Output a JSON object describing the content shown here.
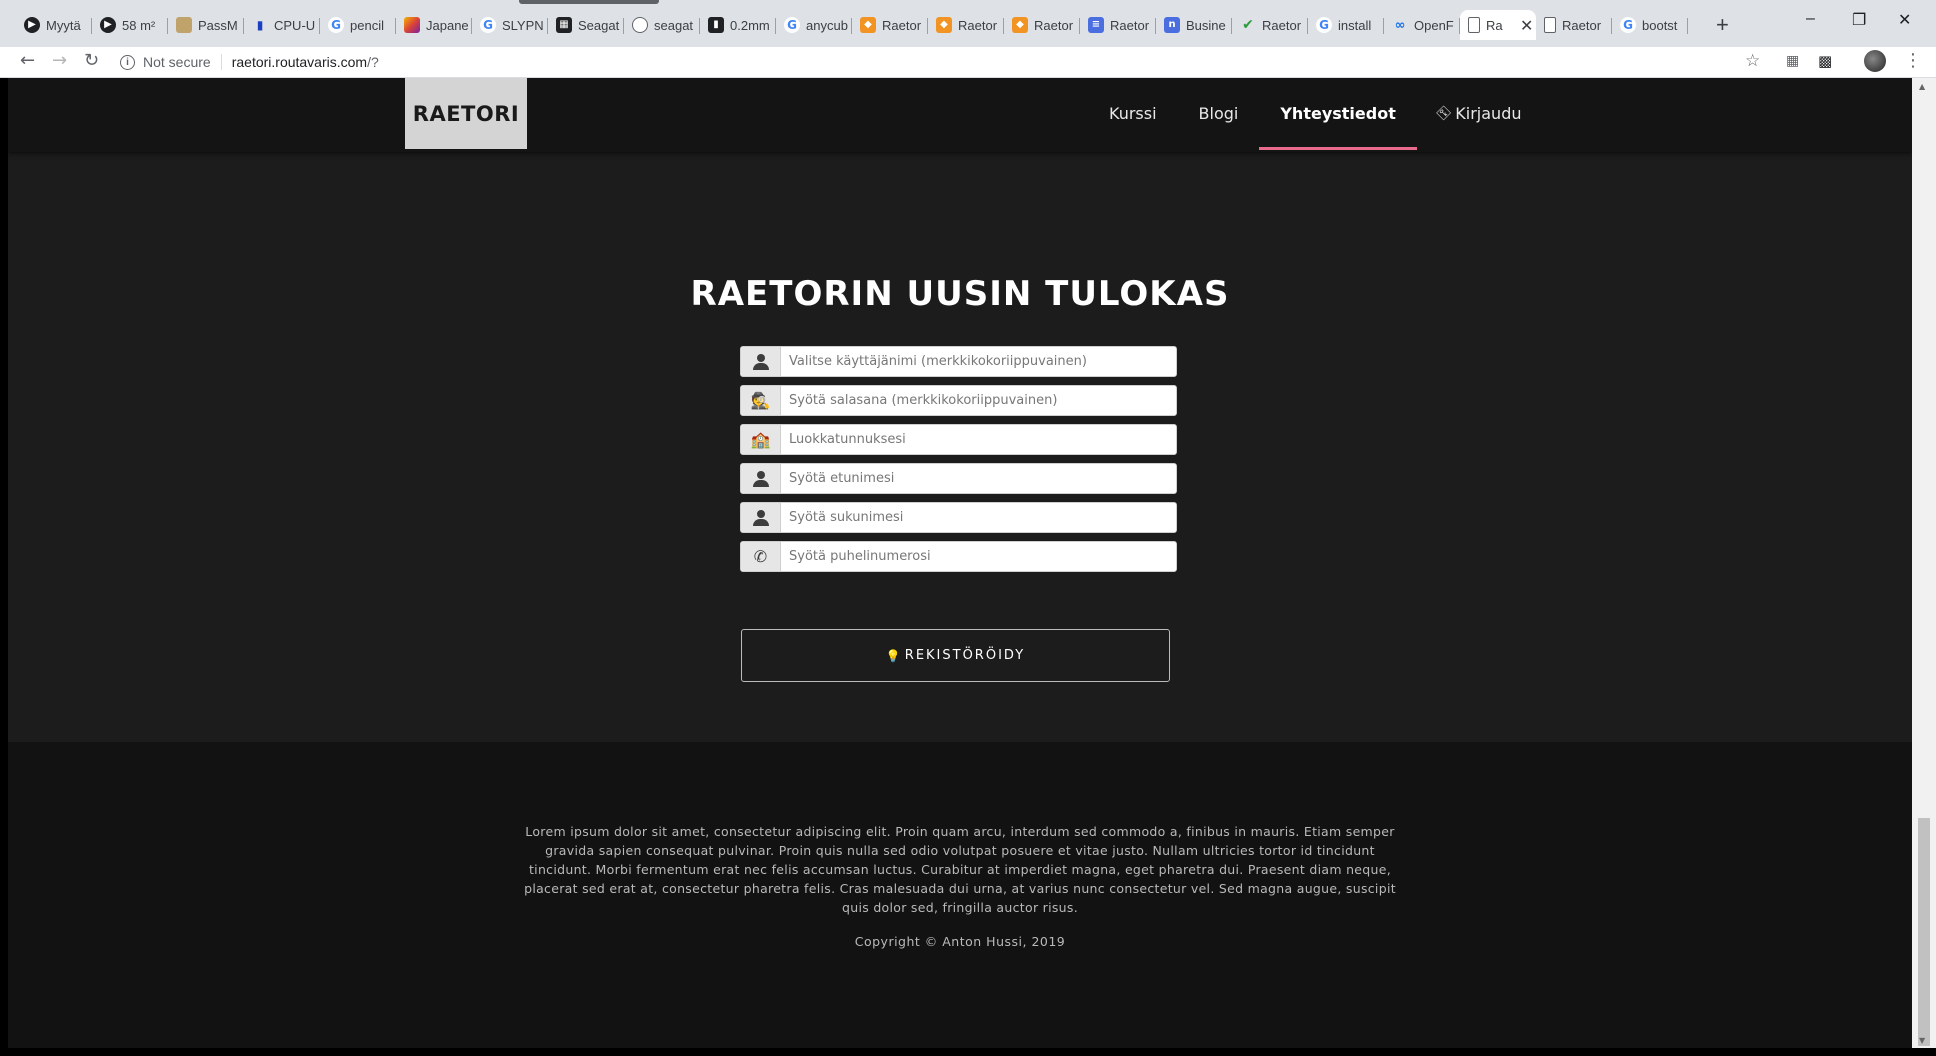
{
  "browser": {
    "tabs": [
      {
        "label": "Myytä",
        "icon": "circle-play-icon"
      },
      {
        "label": "58 m²",
        "icon": "circle-play-icon"
      },
      {
        "label": "PassM",
        "icon": "book-icon"
      },
      {
        "label": "CPU-U",
        "icon": "bar-chart-icon"
      },
      {
        "label": "pencil",
        "icon": "google-icon"
      },
      {
        "label": "Japane",
        "icon": "multicolor-icon"
      },
      {
        "label": "SLYPN",
        "icon": "google-icon"
      },
      {
        "label": "Seagat",
        "icon": "grid-icon"
      },
      {
        "label": "seagat",
        "icon": "lock-icon"
      },
      {
        "label": "0.2mm",
        "icon": "dark-square-icon"
      },
      {
        "label": "anycub",
        "icon": "google-icon"
      },
      {
        "label": "Raetor",
        "icon": "orange-icon"
      },
      {
        "label": "Raetor",
        "icon": "orange-icon"
      },
      {
        "label": "Raetor",
        "icon": "orange-icon"
      },
      {
        "label": "Raetor",
        "icon": "doc-blue-icon"
      },
      {
        "label": "Busine",
        "icon": "circle-blue-icon"
      },
      {
        "label": "Raetor",
        "icon": "check-icon"
      },
      {
        "label": "install",
        "icon": "google-icon"
      },
      {
        "label": "OpenF",
        "icon": "link-icon"
      },
      {
        "label": "Ra",
        "icon": "page-icon",
        "active": true
      },
      {
        "label": "Raetor",
        "icon": "page-icon"
      },
      {
        "label": "bootst",
        "icon": "google-icon"
      }
    ],
    "close_glyph": "✕",
    "new_tab_glyph": "+",
    "not_secure": "Not secure",
    "url_host": "raetori.routavaris.com",
    "url_path": "/?"
  },
  "navbar": {
    "brand": "RAETORI",
    "links": [
      {
        "label": "Kurssi",
        "active": false
      },
      {
        "label": "Blogi",
        "active": false
      },
      {
        "label": "Yhteystiedot",
        "active": true
      },
      {
        "label": "Kirjaudu",
        "active": false
      }
    ]
  },
  "main": {
    "title": "RAETORIN UUSIN TULOKAS",
    "fields": [
      {
        "icon": "user-icon",
        "placeholder": "Valitse käyttäjänimi (merkkikokoriippuvainen)"
      },
      {
        "icon": "user-secret-icon",
        "placeholder": "Syötä salasana (merkkikokoriippuvainen)"
      },
      {
        "icon": "school-icon",
        "placeholder": "Luokkatunnuksesi"
      },
      {
        "icon": "user-icon",
        "placeholder": "Syötä etunimesi"
      },
      {
        "icon": "user-icon",
        "placeholder": "Syötä sukunimesi"
      },
      {
        "icon": "phone-icon",
        "placeholder": "Syötä puhelinumerosi"
      }
    ],
    "register_label": "REKISTÖRÖIDY"
  },
  "footer": {
    "lorem": "Lorem ipsum dolor sit amet, consectetur adipiscing elit. Proin quam arcu, interdum sed commodo a, finibus in mauris. Etiam semper gravida sapien consequat pulvinar. Proin quis nulla sed odio volutpat posuere et vitae justo. Nullam ultricies tortor id tincidunt tincidunt. Morbi fermentum erat nec felis accumsan luctus. Curabitur at imperdiet magna, eget pharetra dui. Praesent diam neque, placerat sed erat at, consectetur pharetra felis. Cras malesuada dui urna, at varius nunc consectetur vel. Sed magna augue, suscipit quis dolor sed, fringilla auctor risus.",
    "copyright": "Copyright © Anton Hussi, 2019"
  },
  "colors": {
    "accent": "#e86a8c",
    "page_bg": "#1c1c1c",
    "navbar_bg": "#141414",
    "brand_bg": "#d4d4d4",
    "footer_bg": "#121212"
  }
}
